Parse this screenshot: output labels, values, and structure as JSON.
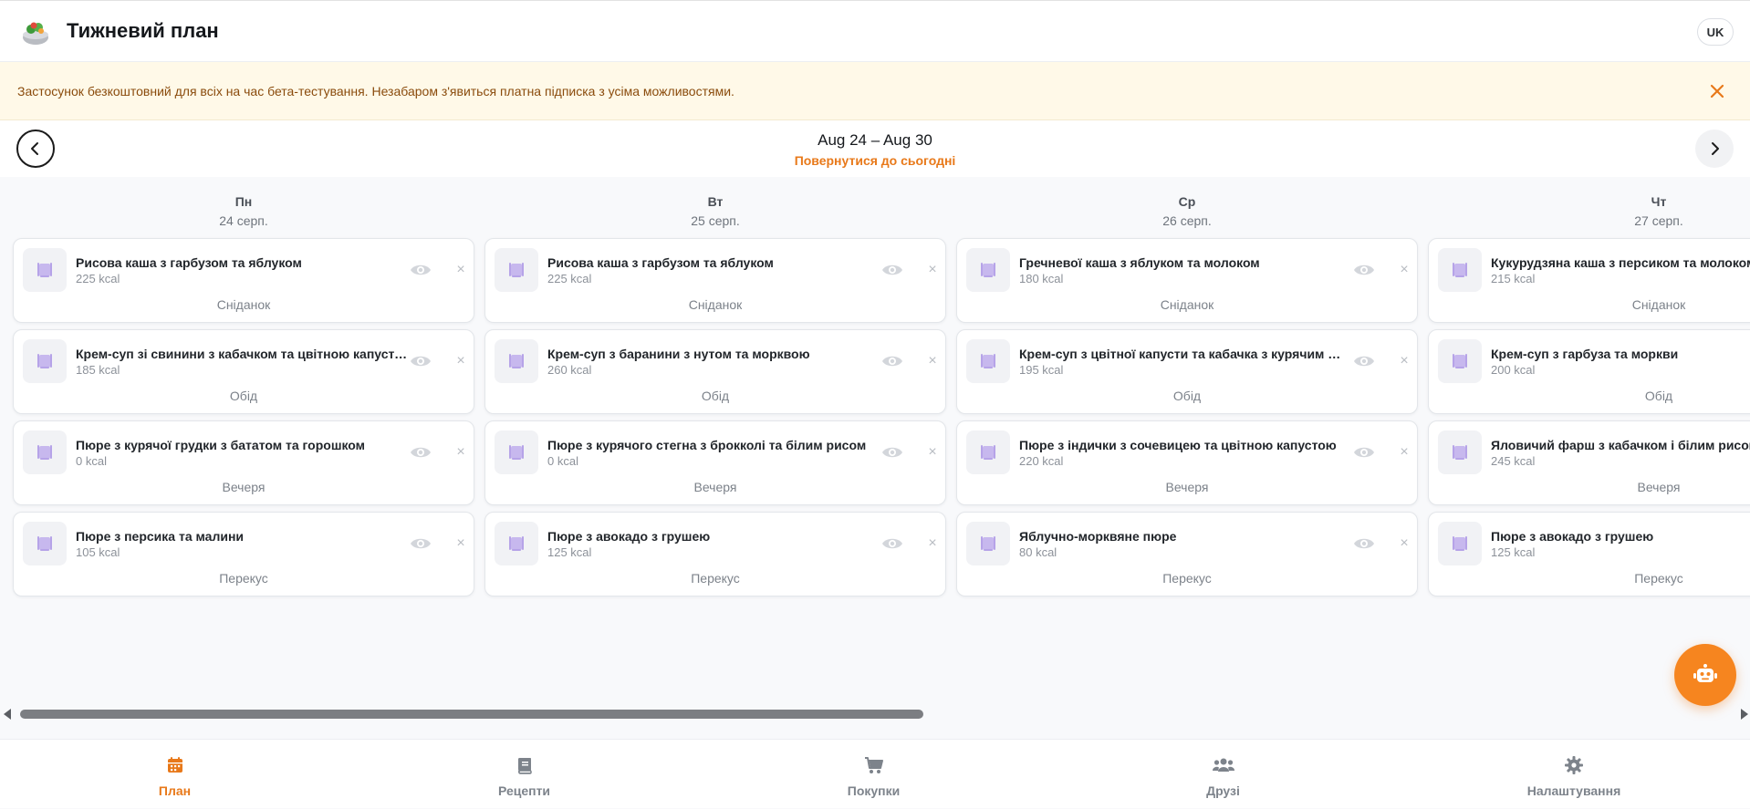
{
  "app": {
    "title": "Тижневий план",
    "lang": "UK",
    "accent": "#f6851f"
  },
  "banner": {
    "text": "Застосунок безкоштовний для всіх на час бета-тестування. Незабаром з'явиться платна підписка з усіма можливостями."
  },
  "week": {
    "range": "Aug 24 – Aug 30",
    "back_today": "Повернутися до сьогодні"
  },
  "days": [
    {
      "name": "Пн",
      "date": "24 серп.",
      "meals": [
        {
          "name": "Рисова каша з гарбузом та яблуком",
          "kcal": "225 kcal",
          "type": "Сніданок"
        },
        {
          "name": "Крем-суп зі свинини з кабачком та цвітною капусто…",
          "kcal": "185 kcal",
          "type": "Обід"
        },
        {
          "name": "Пюре з курячої грудки з бататом та горошком",
          "kcal": "0 kcal",
          "type": "Вечеря"
        },
        {
          "name": "Пюре з персика та малини",
          "kcal": "105 kcal",
          "type": "Перекус"
        }
      ]
    },
    {
      "name": "Вт",
      "date": "25 серп.",
      "meals": [
        {
          "name": "Рисова каша з гарбузом та яблуком",
          "kcal": "225 kcal",
          "type": "Сніданок"
        },
        {
          "name": "Крем-суп з баранини з нутом та морквою",
          "kcal": "260 kcal",
          "type": "Обід"
        },
        {
          "name": "Пюре з курячого стегна з брокколі та білим рисом",
          "kcal": "0 kcal",
          "type": "Вечеря"
        },
        {
          "name": "Пюре з авокадо з грушею",
          "kcal": "125 kcal",
          "type": "Перекус"
        }
      ]
    },
    {
      "name": "Ср",
      "date": "26 серп.",
      "meals": [
        {
          "name": "Гречневої каша з яблуком та молоком",
          "kcal": "180 kcal",
          "type": "Сніданок"
        },
        {
          "name": "Крем-суп з цвітної капусти та кабачка з курячим …",
          "kcal": "195 kcal",
          "type": "Обід"
        },
        {
          "name": "Пюре з індички з сочевицею та цвітною капустою",
          "kcal": "220 kcal",
          "type": "Вечеря"
        },
        {
          "name": "Яблучно-морквяне пюре",
          "kcal": "80 kcal",
          "type": "Перекус"
        }
      ]
    },
    {
      "name": "Чт",
      "date": "27 серп.",
      "meals": [
        {
          "name": "Кукурудзяна каша з персиком та молоком",
          "kcal": "215 kcal",
          "type": "Сніданок"
        },
        {
          "name": "Крем-суп з гарбуза та моркви",
          "kcal": "200 kcal",
          "type": "Обід"
        },
        {
          "name": "Яловичий фарш з кабачком і білим рисом",
          "kcal": "245 kcal",
          "type": "Вечеря"
        },
        {
          "name": "Пюре з авокадо з грушею",
          "kcal": "125 kcal",
          "type": "Перекус"
        }
      ]
    }
  ],
  "nav": {
    "plan": "План",
    "recipes": "Рецепти",
    "shopping": "Покупки",
    "friends": "Друзі",
    "settings": "Налаштування"
  }
}
